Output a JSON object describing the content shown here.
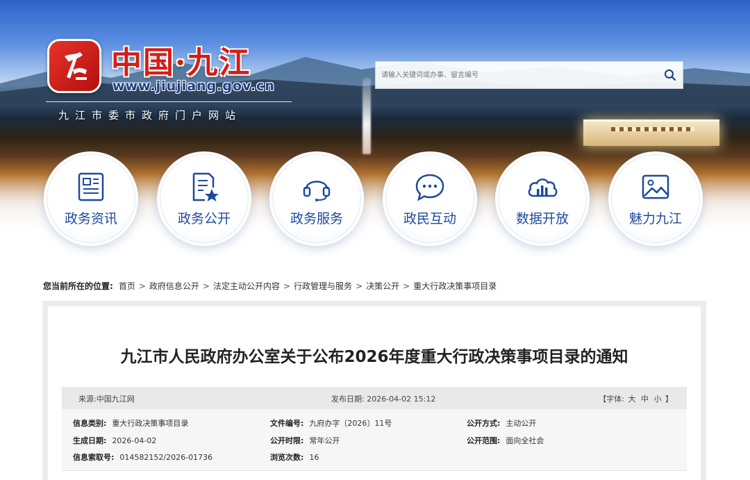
{
  "header": {
    "logo_title": "中国·九江",
    "logo_url": "www.jiujiang.gov.cn",
    "logo_subtitle": "九江市委市政府门户网站",
    "search_placeholder": "请输入关键词或办事、留言编号"
  },
  "nav": [
    {
      "label": "政务资讯",
      "icon": "newspaper-icon"
    },
    {
      "label": "政务公开",
      "icon": "document-star-icon"
    },
    {
      "label": "政务服务",
      "icon": "headset-icon"
    },
    {
      "label": "政民互动",
      "icon": "chat-bubble-icon"
    },
    {
      "label": "数据开放",
      "icon": "cloud-chart-icon"
    },
    {
      "label": "魅力九江",
      "icon": "picture-icon"
    }
  ],
  "breadcrumb": {
    "lead": "您当前所在的位置:",
    "items": [
      "首页",
      "政府信息公开",
      "法定主动公开内容",
      "行政管理与服务",
      "决策公开",
      "重大行政决策事项目录"
    ],
    "separator": ">"
  },
  "article": {
    "title": "九江市人民政府办公室关于公布2026年度重大行政决策事项目录的通知",
    "source_label": "来源:",
    "source_value": "中国九江网",
    "date_label": "发布日期:",
    "date_value": "2026-04-02 15:12",
    "font_prefix": "【字体:",
    "font_large": "大",
    "font_medium": "中",
    "font_small": "小",
    "font_suffix": "】"
  },
  "info": {
    "category_label": "信息类别:",
    "category_value": "重大行政决策事项目录",
    "doc_no_label": "文件编号:",
    "doc_no_value": "九府办字〔2026〕11号",
    "open_mode_label": "公开方式:",
    "open_mode_value": "主动公开",
    "created_label": "生成日期:",
    "created_value": "2026-04-02",
    "open_period_label": "公开时限:",
    "open_period_value": "常年公开",
    "open_scope_label": "公开范围:",
    "open_scope_value": "面向全社会",
    "index_label": "信息索取号:",
    "index_value": "014582152/2026-01736",
    "views_label": "浏览次数:",
    "views_value": "16"
  },
  "colors": {
    "brand_red": "#d61d16",
    "brand_blue": "#1b4a9c",
    "url_blue": "#1d3f8a"
  }
}
